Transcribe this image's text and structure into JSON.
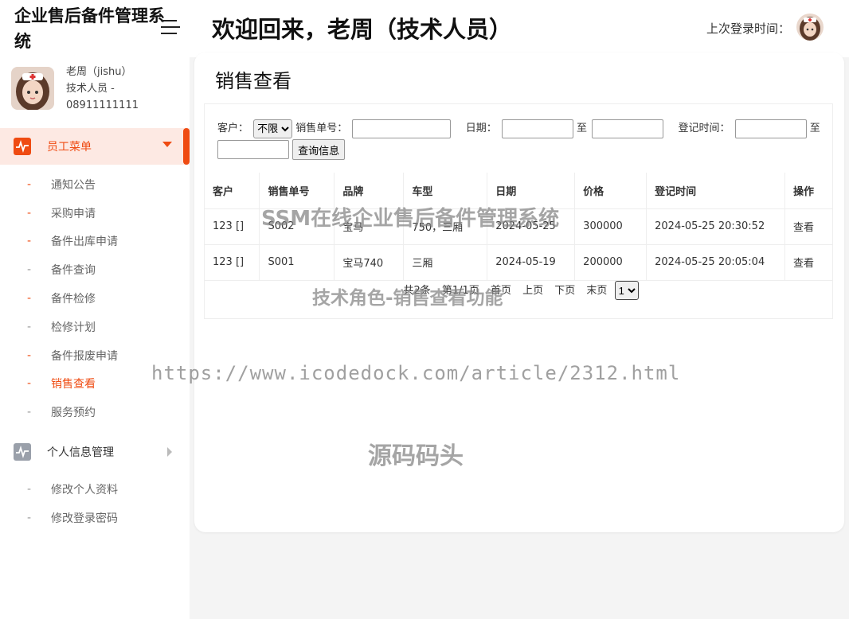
{
  "header": {
    "brand": "企业售后备件管理系统",
    "welcome": "欢迎回来，老周（技术人员）",
    "last_login_label": "上次登录时间："
  },
  "profile": {
    "name": "老周（jishu）",
    "role": "技术人员 -",
    "phone": "08911111111"
  },
  "sidebar": {
    "group1_label": "员工菜单",
    "group1_items": [
      {
        "label": "通知公告"
      },
      {
        "label": "采购申请"
      },
      {
        "label": "备件出库申请"
      },
      {
        "label": "备件查询"
      },
      {
        "label": "备件检修"
      },
      {
        "label": "检修计划"
      },
      {
        "label": "备件报废申请"
      },
      {
        "label": "销售查看"
      },
      {
        "label": "服务预约"
      }
    ],
    "group2_label": "个人信息管理",
    "group2_items": [
      {
        "label": "修改个人资料"
      },
      {
        "label": "修改登录密码"
      }
    ],
    "accent_color": "#ef4b12"
  },
  "page": {
    "title": "销售查看"
  },
  "search": {
    "customer_label": "客户：",
    "customer_value": "不限",
    "order_label": "销售单号：",
    "date_label": "日期：",
    "to1": "至",
    "reg_label": "登记时间：",
    "to2": "至",
    "query_button": "查询信息"
  },
  "table": {
    "headers": [
      "客户",
      "销售单号",
      "品牌",
      "车型",
      "日期",
      "价格",
      "登记时间",
      "操作"
    ],
    "rows": [
      [
        "123 []",
        "S002",
        "宝马",
        "750，三厢",
        "2024-05-25",
        "300000",
        "2024-05-25 20:30:52",
        "查看"
      ],
      [
        "123 []",
        "S001",
        "宝马740",
        "三厢",
        "2024-05-19",
        "200000",
        "2024-05-25 20:05:04",
        "查看"
      ]
    ]
  },
  "pager": {
    "total": "共2条",
    "page_of": "第1/1页",
    "first": "首页",
    "prev": "上页",
    "next": "下页",
    "last": "末页",
    "current": "1"
  },
  "watermarks": {
    "w1": "SSM在线企业售后备件管理系统",
    "w2": "技术角色-销售查看功能",
    "w3": "https://www.icodedock.com/article/2312.html",
    "w4": "源码码头"
  }
}
